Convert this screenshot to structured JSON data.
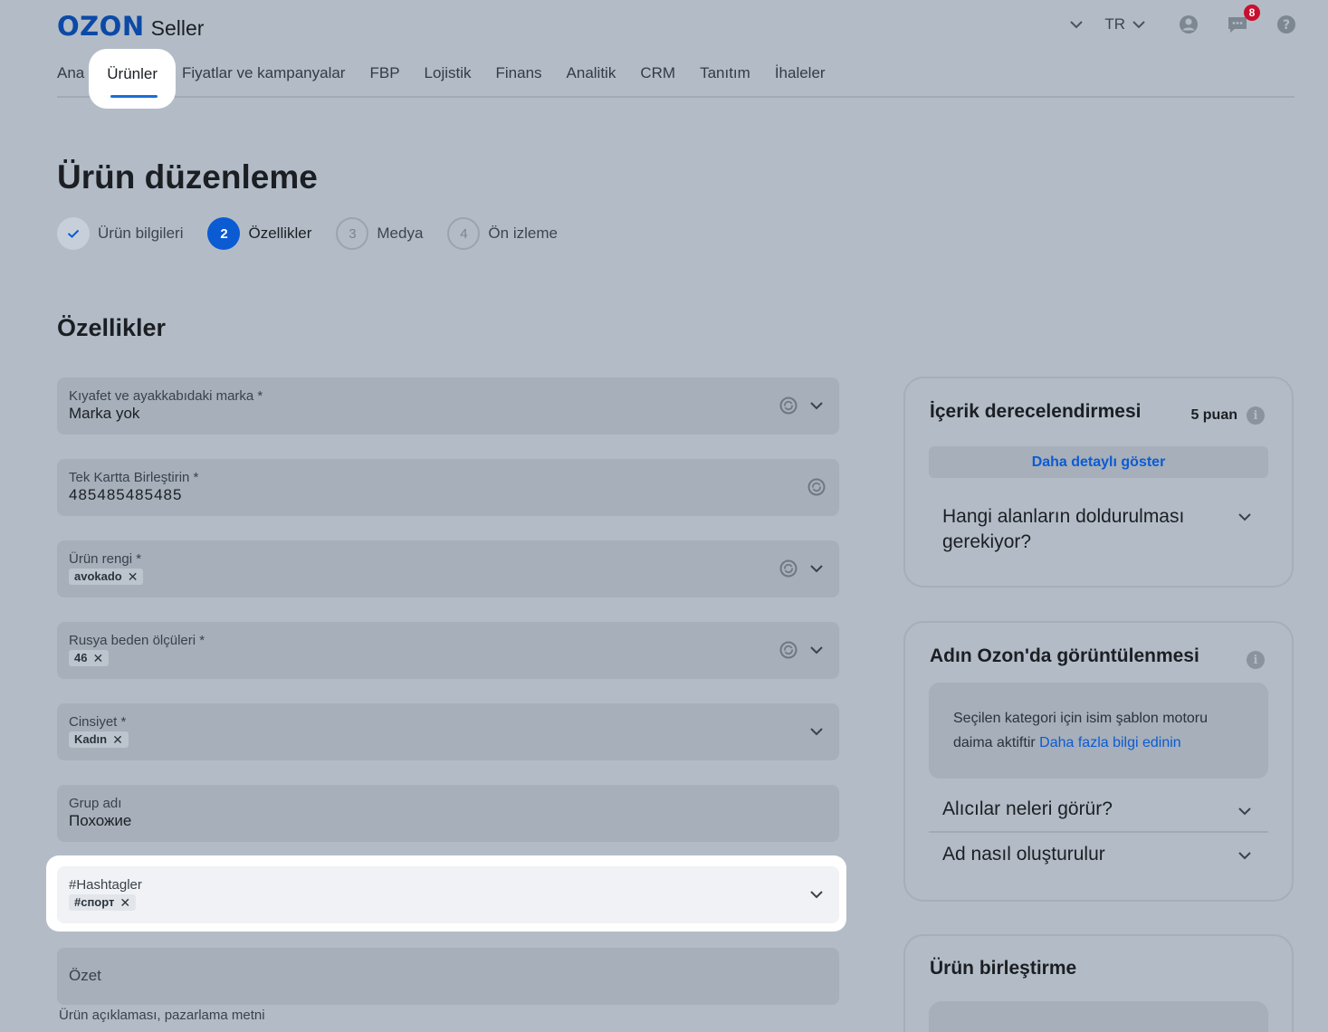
{
  "header": {
    "brand": "OZON",
    "brand_suffix": "Seller",
    "language": "TR",
    "notification_count": "8"
  },
  "nav": {
    "items": [
      "Ana",
      "Ürünler",
      "Fiyatlar ve kampanyalar",
      "FBP",
      "Lojistik",
      "Finans",
      "Analitik",
      "CRM",
      "Tanıtım",
      "İhaleler"
    ],
    "active": "Ürünler"
  },
  "page": {
    "title": "Ürün düzenleme",
    "section_title": "Özellikler"
  },
  "steps": [
    {
      "number": "",
      "label": "Ürün bilgileri",
      "state": "done"
    },
    {
      "number": "2",
      "label": "Özellikler",
      "state": "current"
    },
    {
      "number": "3",
      "label": "Medya",
      "state": "todo"
    },
    {
      "number": "4",
      "label": "Ön izleme",
      "state": "todo"
    }
  ],
  "fields": {
    "brand": {
      "label": "Kıyafet ve ayakkabıdaki marka *",
      "value": "Marka yok"
    },
    "merge": {
      "label": "Tek Kartta Birleştirin *",
      "value": "485485485485"
    },
    "color": {
      "label": "Ürün rengi *",
      "chip": "avokado"
    },
    "size": {
      "label": "Rusya beden ölçüleri *",
      "chip": "46"
    },
    "gender": {
      "label": "Cinsiyet *",
      "chip": "Kadın"
    },
    "group": {
      "label": "Grup adı",
      "value": "Похожие"
    },
    "hashtags": {
      "label": "#Hashtagler",
      "chip": "#спорт"
    },
    "summary": {
      "label": "Özet",
      "helper": "Ürün açıklaması, pazarlama metni"
    }
  },
  "rating_card": {
    "title": "İçerik derecelendirmesi",
    "score": "5 puan",
    "detail_button": "Daha detaylı göster",
    "question": "Hangi alanların doldurulması gerekiyor?"
  },
  "name_card": {
    "title": "Adın Ozon'da görüntülenmesi",
    "note": "Seçilen kategori için isim şablon motoru daima aktiftir",
    "note_link": "Daha fazla bilgi edinin",
    "acc1": "Alıcılar neleri görür?",
    "acc2": "Ad nasıl oluşturulur"
  },
  "merge_card": {
    "title": "Ürün birleştirme"
  },
  "colors": {
    "accent": "#0b5bd3",
    "brand": "#0b4aa6",
    "badge": "#c8102e"
  }
}
